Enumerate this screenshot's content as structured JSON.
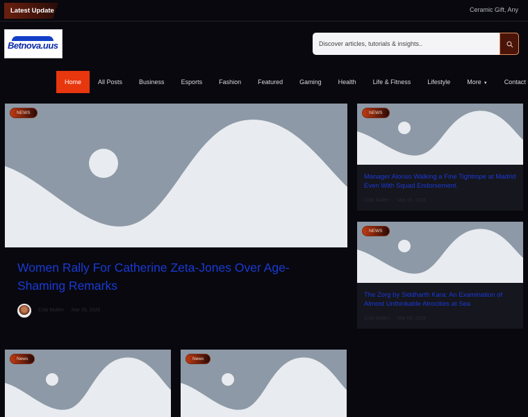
{
  "topbar": {
    "latest_label": "Latest Update",
    "ticker_text": "Ceramic Gift, Any"
  },
  "brand": {
    "logo_text": "Betnova.uus"
  },
  "search": {
    "placeholder": "Discover articles, tutorials & insights.."
  },
  "nav": {
    "items": [
      {
        "label": "Home"
      },
      {
        "label": "All Posts"
      },
      {
        "label": "Business"
      },
      {
        "label": "Esports"
      },
      {
        "label": "Fashion"
      },
      {
        "label": "Featured"
      },
      {
        "label": "Gaming"
      },
      {
        "label": "Health"
      },
      {
        "label": "Life & Fitness"
      },
      {
        "label": "Lifestyle"
      },
      {
        "label": "More"
      },
      {
        "label": "Contact Us"
      }
    ]
  },
  "featured": {
    "badge": "NEWS",
    "title": "Women Rally For Catherine Zeta-Jones Over Age-Shaming Remarks",
    "author": "Cobi Mullen",
    "date": "Mar 05, 2026"
  },
  "side_posts": [
    {
      "badge": "NEWS",
      "title": "Manager Alonso Walking a Fine Tightrope at Madrid Even With Squad Endorsement.",
      "author": "Cobi Mullen",
      "date": "Mar 08, 2026"
    },
    {
      "badge": "NEWS",
      "title": "The Zorg by Siddharth Kara: An Examination of Almost Unthinkable Atrocities at Sea",
      "author": "Cobi Mullen",
      "date": "Mar 08, 2026"
    }
  ],
  "bottom_posts": [
    {
      "badge": "News"
    },
    {
      "badge": "News"
    }
  ],
  "colors": {
    "accent": "#e8360e",
    "link": "#1a3ad6",
    "background": "#08080e",
    "placeholder_image": "#8d99a6"
  }
}
